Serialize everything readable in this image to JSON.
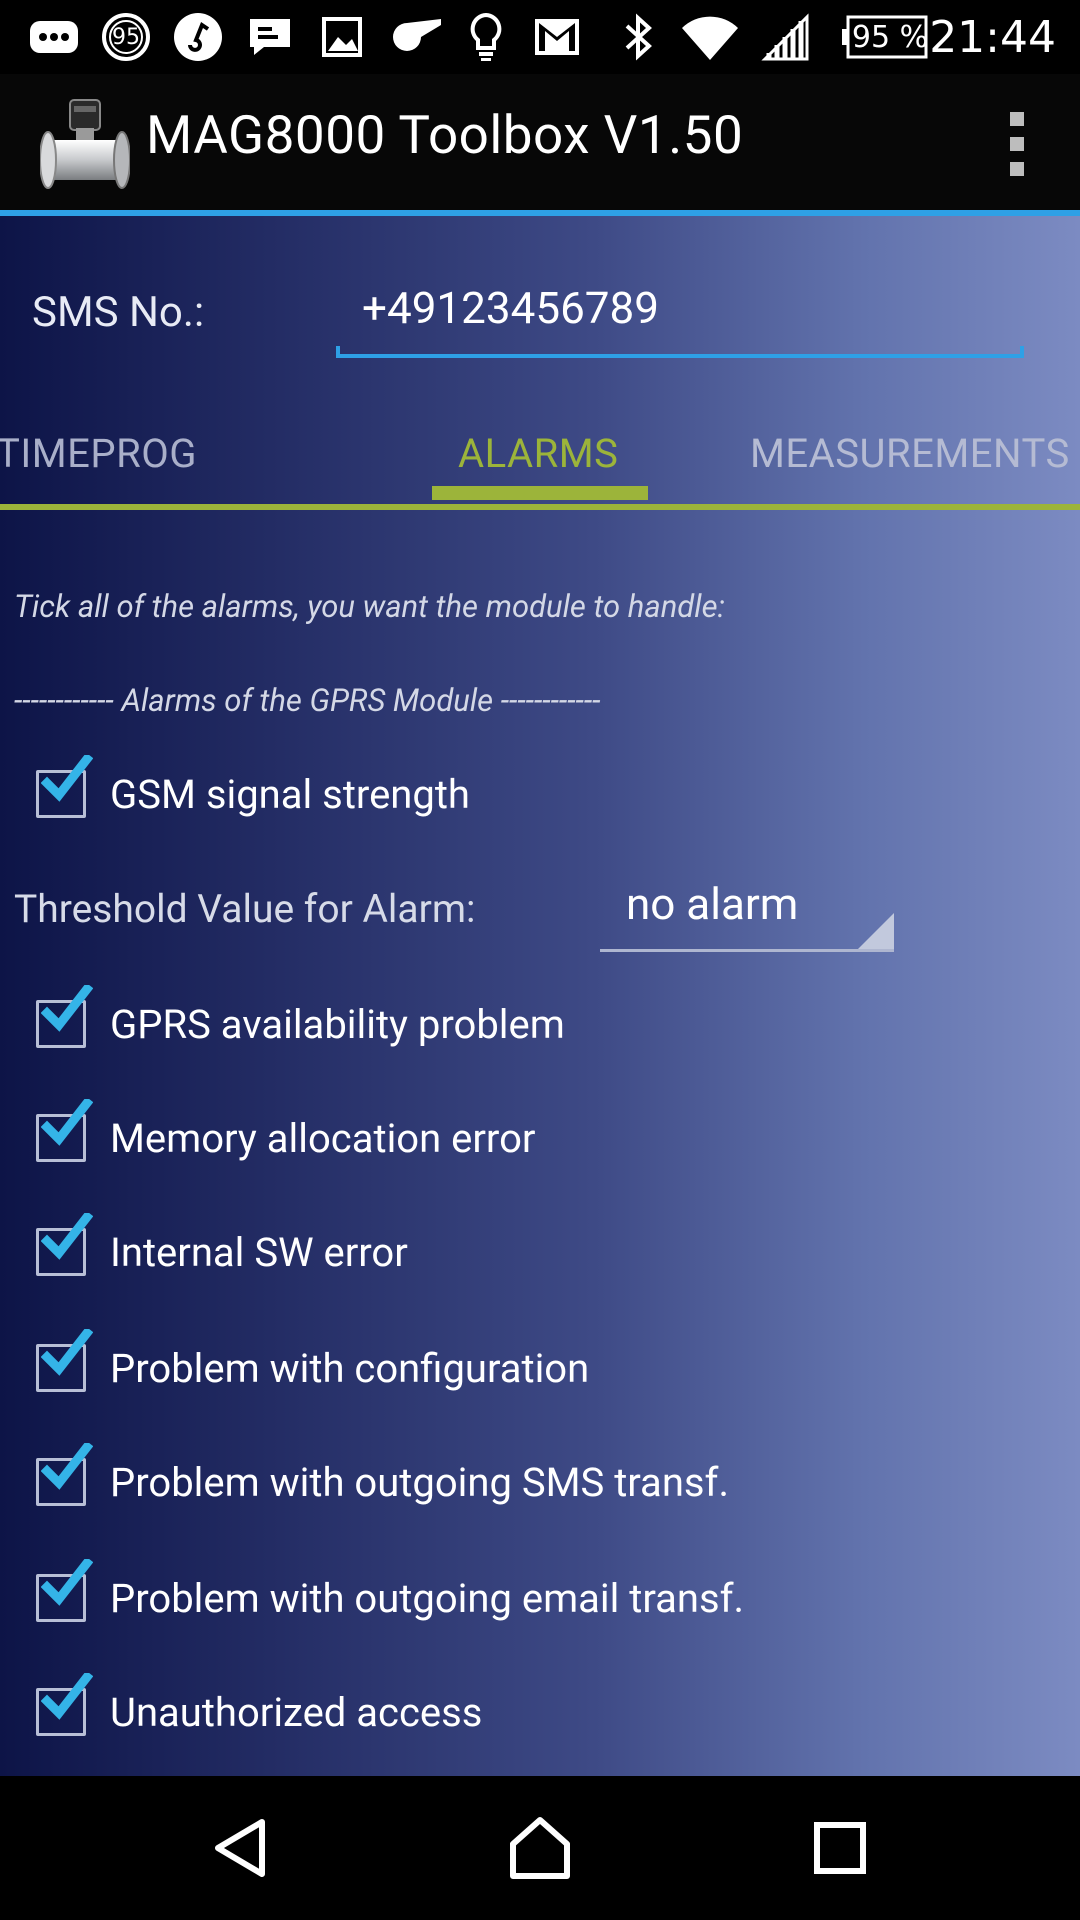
{
  "status_bar": {
    "icons": [
      "more-notifications-icon",
      "badge-95-icon",
      "music-icon",
      "message-icon",
      "image-icon",
      "whistle-icon",
      "lightbulb-icon",
      "gmail-icon",
      "bluetooth-icon",
      "wifi-icon",
      "cell-signal-icon",
      "battery-icon"
    ],
    "badge_text": "95",
    "battery_text": "95 %",
    "time": "21:44"
  },
  "action_bar": {
    "title": "MAG8000 Toolbox V1.50"
  },
  "sms": {
    "label": "SMS No.:",
    "value": "+49123456789"
  },
  "tabs": [
    {
      "label": "TIMEPROG",
      "selected": false
    },
    {
      "label": "ALARMS",
      "selected": true
    },
    {
      "label": "MEASUREMENTS",
      "selected": false
    }
  ],
  "hint": "Tick all of the alarms, you want the module to handle:",
  "section_title": "------------ Alarms of the GPRS Module ------------",
  "alarms": [
    {
      "label": "GSM signal strength",
      "checked": true
    },
    {
      "label": "GPRS availability problem",
      "checked": true
    },
    {
      "label": "Memory allocation error",
      "checked": true
    },
    {
      "label": "Internal SW error",
      "checked": true
    },
    {
      "label": "Problem with configuration",
      "checked": true
    },
    {
      "label": "Problem with outgoing SMS transf.",
      "checked": true
    },
    {
      "label": "Problem with outgoing email transf.",
      "checked": true
    },
    {
      "label": "Unauthorized access",
      "checked": true
    }
  ],
  "threshold": {
    "label": "Threshold Value for Alarm:",
    "value": "no alarm"
  },
  "colors": {
    "accent_blue": "#2ea0e6",
    "tab_green": "#9cb43a",
    "check_blue": "#34b4e8"
  }
}
